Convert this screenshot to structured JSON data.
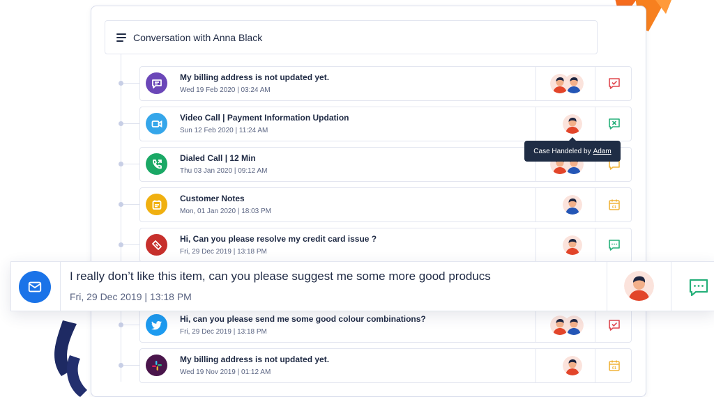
{
  "header": {
    "title": "Conversation with Anna Black"
  },
  "rows": [
    {
      "title": "My billing address is not updated yet.",
      "date": "Wed 19 Feb 2020  |  03:24 AM",
      "icon": "chat-icon",
      "icon_color": "#6b47b8",
      "avatars": 2,
      "action": "check-icon",
      "action_color": "#e0484f"
    },
    {
      "title": "Video Call  |  Payment Information Updation",
      "date": "Sun 12 Feb 2020  |  11:24 AM",
      "icon": "video-icon",
      "icon_color": "#35a6ea",
      "avatars": 1,
      "action": "x-icon",
      "action_color": "#26b07a"
    },
    {
      "title": "Dialed Call  |  12 Min",
      "date": "Thu 03 Jan 2020  |  09:12 AM",
      "icon": "phone-icon",
      "icon_color": "#1aa865",
      "avatars": 2,
      "action": "message-icon",
      "action_color": "#f0b43a"
    },
    {
      "title": "Customer Notes",
      "date": "Mon, 01 Jan 2020  |  18:03 PM",
      "icon": "notes-icon",
      "icon_color": "#f0b010",
      "avatars": 1,
      "action": "calendar-icon",
      "action_color": "#f0b43a"
    },
    {
      "title": "Hi, Can you please resolve my credit card issue ?",
      "date": "Fri, 29 Dec 2019  |  13:18 PM",
      "icon": "ticket-icon",
      "icon_color": "#c7302c",
      "avatars": 1,
      "action": "chat-dots-icon",
      "action_color": "#26b07a"
    },
    {
      "title": "Hi, can you please send me some good colour combinations?",
      "date": "Fri, 29 Dec 2019  |  13:18 PM",
      "icon": "twitter-icon",
      "icon_color": "#1d9bf0",
      "avatars": 2,
      "action": "check-icon",
      "action_color": "#e0484f"
    },
    {
      "title": "My billing address is not updated yet.",
      "date": "Wed 19 Nov 2019  |  01:12 AM",
      "icon": "slack-icon",
      "icon_color": "#4a154b",
      "avatars": 1,
      "action": "calendar-icon",
      "action_color": "#f0b43a"
    }
  ],
  "featured": {
    "title": "I really don’t like this item, can you please suggest me some more good producs",
    "date": "Fri, 29 Dec 2019  |  13:18 PM",
    "icon": "mail-icon",
    "icon_color": "#1a73e8",
    "action": "chat-dots-icon",
    "action_color": "#26b07a"
  },
  "tooltip": {
    "text": "Case Handeled by",
    "link": "Adam"
  }
}
